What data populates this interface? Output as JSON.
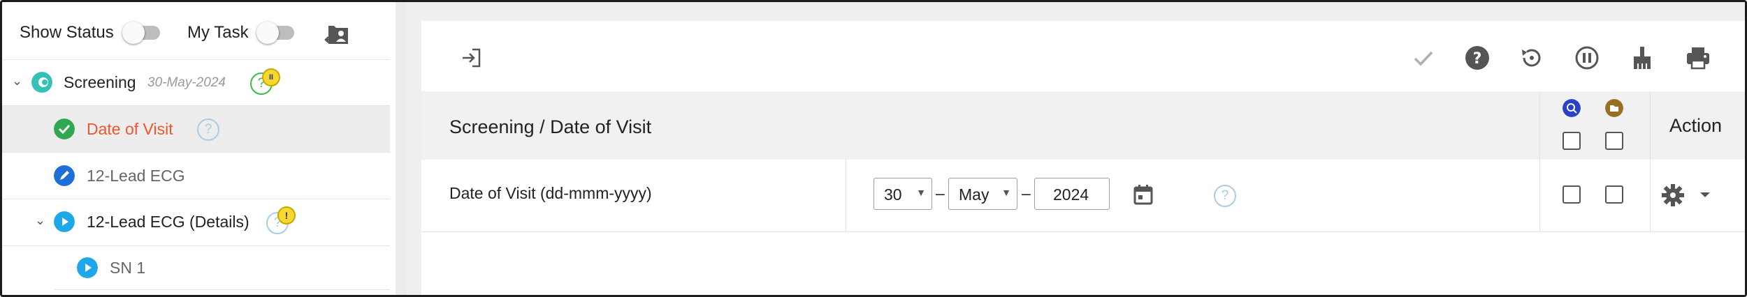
{
  "left_panel": {
    "show_status_label": "Show Status",
    "my_task_label": "My Task",
    "tree": [
      {
        "label": "Screening",
        "date": "30-May-2024"
      },
      {
        "label": "Date of Visit"
      },
      {
        "label": "12-Lead ECG"
      },
      {
        "label": "12-Lead ECG (Details)"
      },
      {
        "label": "SN 1"
      }
    ],
    "help_glyph": "?",
    "pause_badge": "II",
    "warn_badge": "!"
  },
  "main": {
    "section_title": "Screening / Date of Visit",
    "action_label": "Action",
    "field_label": "Date of Visit (dd-mmm-yyyy)",
    "day_value": "30",
    "month_value": "May",
    "year_value": "2024",
    "separator": "–",
    "help_glyph": "?"
  },
  "colors": {
    "accent_orange": "#f2542d",
    "green": "#2fa84f",
    "blue_edit": "#1e6fd6",
    "cyan_play": "#1ea7e9",
    "teal": "#34c2b6",
    "query_blue": "#2b3fc7",
    "folder_brown": "#9a6e22"
  }
}
